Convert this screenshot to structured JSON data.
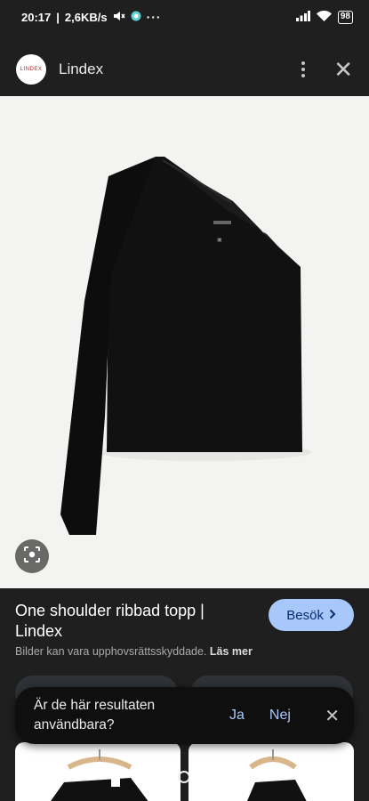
{
  "status_bar": {
    "time": "20:17",
    "speed": "2,6KB/s",
    "more": "···",
    "battery": "98"
  },
  "header": {
    "logo_text": "LINDEX",
    "site_name": "Lindex"
  },
  "product": {
    "title": "One shoulder ribbad topp | Lindex",
    "visit_label": "Besök",
    "copyright_note": "Bilder kan vara upphovsrättsskyddade.",
    "read_more": "Läs mer"
  },
  "feedback": {
    "question": "Är de här resultaten användbara?",
    "yes": "Ja",
    "no": "Nej"
  },
  "icons": {
    "mute": "mute-icon",
    "signal": "signal-icon",
    "wifi": "wifi-icon",
    "more": "more-vert-icon",
    "close": "close-icon",
    "lens": "lens-icon",
    "chevron": "chevron-right-icon"
  },
  "colors": {
    "accent": "#a8c7fa",
    "background": "#1f1f1f"
  }
}
